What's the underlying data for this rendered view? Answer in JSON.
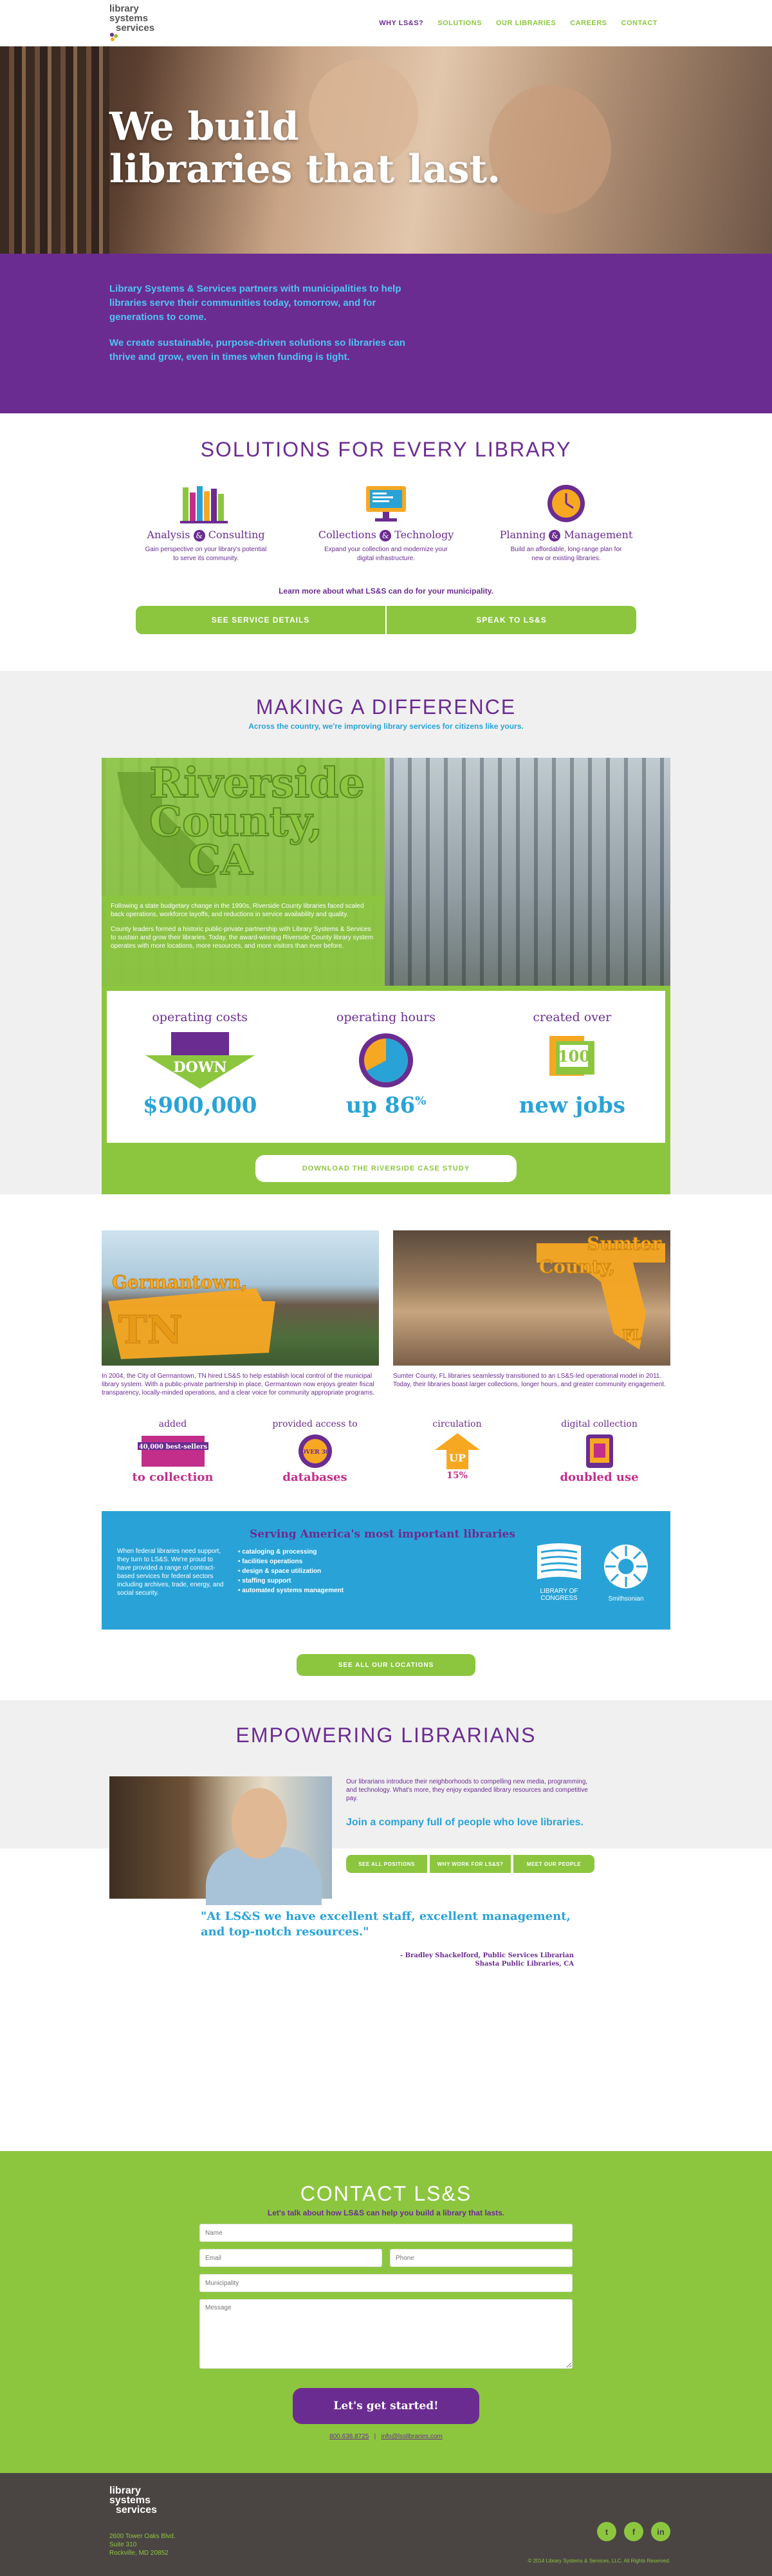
{
  "header": {
    "logo_lines": [
      "library",
      "systems",
      "services"
    ],
    "nav": [
      "WHY LS&S?",
      "SOLUTIONS",
      "OUR LIBRARIES",
      "CAREERS",
      "CONTACT"
    ]
  },
  "hero": {
    "line1": "We build",
    "line2": "libraries that last."
  },
  "intro": {
    "p1": "Library Systems & Services partners with municipalities to help libraries serve their communities today, tomorrow, and for generations to come.",
    "p2": "We create sustainable, purpose-driven solutions so libraries can thrive and grow, even in times when funding is tight."
  },
  "solutions": {
    "title": "SOLUTIONS FOR EVERY LIBRARY",
    "items": [
      {
        "a": "Analysis",
        "b": "Consulting",
        "desc": "Gain perspective on your library's potential to serve its community."
      },
      {
        "a": "Collections",
        "b": "Technology",
        "desc": "Expand your collection and modernize your digital infrastructure."
      },
      {
        "a": "Planning",
        "b": "Management",
        "desc": "Build an affordable, long-range plan for new or existing libraries."
      }
    ],
    "amp": "&",
    "learn": "Learn more about what LS&S can do for your municipality.",
    "btn_details": "SEE SERVICE DETAILS",
    "btn_speak": "SPEAK TO LS&S"
  },
  "difference": {
    "title": "MAKING A DIFFERENCE",
    "subtitle": "Across the country, we're improving library services for citizens like yours.",
    "riverside": {
      "name_line1": "Riverside",
      "name_line2": "County,",
      "name_line3": "CA",
      "p1": "Following a state budgetary change in the 1990s, Riverside County libraries faced scaled back operations, workforce layoffs, and reductions in service availability and quality.",
      "p2": "County leaders formed a historic public-private partnership with Library Systems & Services to sustain and grow their libraries. Today, the award-winning Riverside County library system operates with more locations, more resources, and more visitors than ever before.",
      "stats": [
        {
          "cap": "operating costs",
          "icon_text": "DOWN",
          "val": "$900,000"
        },
        {
          "cap": "operating hours",
          "icon_text": "",
          "val": "up 86",
          "sup": "%"
        },
        {
          "cap": "created over",
          "icon_text": "100",
          "val": "new jobs"
        }
      ],
      "download": "DOWNLOAD THE RIVERSIDE CASE STUDY"
    },
    "germantown": {
      "name_line1": "Germantown,",
      "name_line2": "TN",
      "text": "In 2004, the City of Germantown, TN hired LS&S to help establish local control of the municipal library system. With a public-private partnership in place, Germantown now enjoys greater fiscal transparency, locally-minded operations, and a clear voice for community appropriate programs."
    },
    "sumter": {
      "name_line1": "Sumter",
      "name_line2": "County,",
      "name_line3": "FL",
      "text": "Sumter County, FL libraries seamlessly transitioned to an LS&S-led operational model in 2011. Today, their libraries boast larger collections, longer hours, and greater community engagement."
    },
    "minis": [
      {
        "cap": "added",
        "icon_text": "40,000 best-sellers",
        "val": "to collection"
      },
      {
        "cap": "provided access to",
        "icon_text": "OVER 30",
        "val": "databases"
      },
      {
        "cap": "circulation",
        "icon_text": "UP",
        "val": "15%"
      },
      {
        "cap": "digital collection",
        "icon_text": "",
        "val": "doubled use"
      }
    ],
    "america": {
      "title": "Serving America's most important libraries",
      "text": "When federal libraries need support, they turn to LS&S. We're proud to have provided a range of contract-based services for federal sectors including archives, trade, energy, and social security.",
      "list": [
        "cataloging & processing",
        "facilities operations",
        "design & space utilization",
        "staffing support",
        "automated systems management"
      ],
      "loc": "LIBRARY OF CONGRESS",
      "smi": "Smithsonian"
    },
    "see_all": "SEE ALL OUR LOCATIONS"
  },
  "empowering": {
    "title": "EMPOWERING LIBRARIANS",
    "text": "Our librarians introduce their neighborhoods to compelling new media, programming, and technology. What's more, they enjoy expanded library resources and competitive pay.",
    "join": "Join a company full of people who love libraries.",
    "btns": [
      "SEE ALL POSITIONS",
      "WHY WORK FOR LS&S?",
      "MEET OUR PEOPLE"
    ],
    "quote": "\"At LS&S we have excellent staff, excellent management, and top-notch resources.\"",
    "by1": "- Bradley Shackelford, Public Services Librarian",
    "by2": "Shasta Public Libraries, CA"
  },
  "contact": {
    "title": "CONTACT LS&S",
    "tag": "Let's talk about how LS&S can help you build a library that lasts.",
    "ph_name": "Name",
    "ph_email": "Email",
    "ph_phone": "Phone",
    "ph_muni": "Municipality",
    "ph_msg": "Message",
    "cta": "Let's get started!",
    "phone": "800.638.8725",
    "email": "info@lsslibraries.com"
  },
  "footer": {
    "addr1": "2600 Tower Oaks Blvd.",
    "addr2": "Suite 310",
    "addr3": "Rockville, MD 20852",
    "copy": "© 2014 Library Systems & Services, LLC. All Rights Reserved."
  },
  "colors": {
    "purple": "#6b2c91",
    "green": "#8cc63f",
    "blue": "#29a3d7",
    "orange": "#f7a823",
    "magenta": "#c22e8a"
  }
}
